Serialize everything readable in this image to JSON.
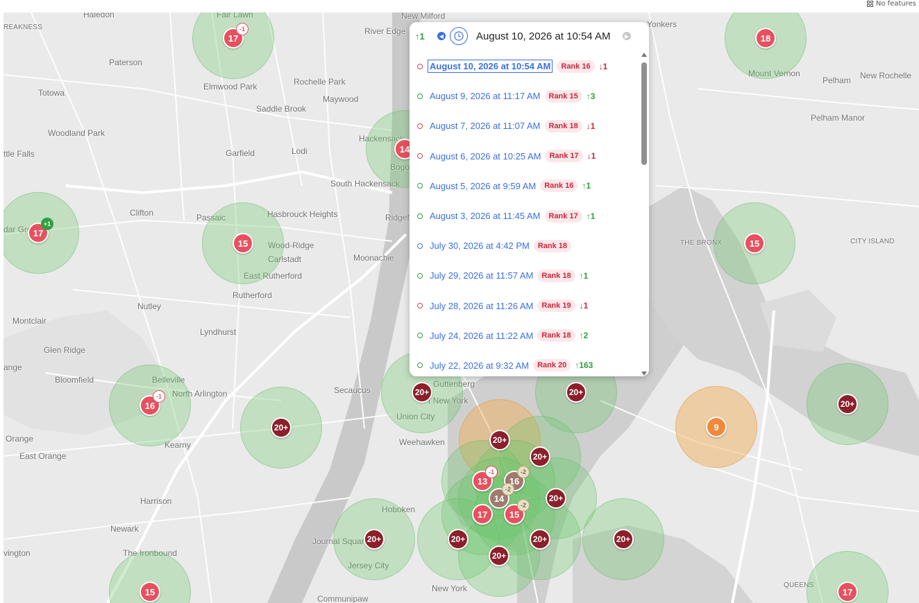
{
  "toolbar": {
    "features_label": "No features",
    "features_icon": "grid-icon"
  },
  "places": [
    {
      "name": "Haledon"
    },
    {
      "name": "Fair Lawn"
    },
    {
      "name": "New Milford"
    },
    {
      "name": "Yonkers"
    },
    {
      "name": "REAKNESS"
    },
    {
      "name": "River Edge"
    },
    {
      "name": "Paterson"
    },
    {
      "name": "Rochelle Park"
    },
    {
      "name": "Elmwood Park"
    },
    {
      "name": "Mount Vernon"
    },
    {
      "name": "Pelham"
    },
    {
      "name": "New Rochelle"
    },
    {
      "name": "Totowa"
    },
    {
      "name": "Maywood"
    },
    {
      "name": "Saddle Brook"
    },
    {
      "name": "Pelham Manor"
    },
    {
      "name": "Woodland Park"
    },
    {
      "name": "Hackensack"
    },
    {
      "name": "ttle Falls"
    },
    {
      "name": "Garfield"
    },
    {
      "name": "Lodi"
    },
    {
      "name": "Bogo"
    },
    {
      "name": "South Hackensack"
    },
    {
      "name": "Clifton"
    },
    {
      "name": "Passaic"
    },
    {
      "name": "Hasbrouck Heights"
    },
    {
      "name": "Ridgef"
    },
    {
      "name": "dar Gro"
    },
    {
      "name": "Wood-Ridge"
    },
    {
      "name": "THE BRONX"
    },
    {
      "name": "CITY ISLAND"
    },
    {
      "name": "Carlstadt"
    },
    {
      "name": "Moonachie"
    },
    {
      "name": "East Rutherford"
    },
    {
      "name": "Rutherford"
    },
    {
      "name": "Nutley"
    },
    {
      "name": "Montclair"
    },
    {
      "name": "Lyndhurst"
    },
    {
      "name": "Glen Ridge"
    },
    {
      "name": "ange"
    },
    {
      "name": "Belleville"
    },
    {
      "name": "Bloomfield"
    },
    {
      "name": "North Arlington"
    },
    {
      "name": "Secaucus"
    },
    {
      "name": "Guttenberg"
    },
    {
      "name": "t New York"
    },
    {
      "name": "Union City"
    },
    {
      "name": "Orange"
    },
    {
      "name": "Kearny"
    },
    {
      "name": "East Orange"
    },
    {
      "name": "Weehawken"
    },
    {
      "name": "Harrison"
    },
    {
      "name": "Hoboken"
    },
    {
      "name": "Newark"
    },
    {
      "name": "Journal Squar"
    },
    {
      "name": "vington"
    },
    {
      "name": "The Ironbound"
    },
    {
      "name": "Jersey City"
    },
    {
      "name": "New York"
    },
    {
      "name": "QUEENS"
    },
    {
      "name": "Communipaw"
    }
  ],
  "markers": [
    {
      "label": "17",
      "kind": "red",
      "delta": "-1",
      "delta_kind": "down"
    },
    {
      "label": "18",
      "kind": "red"
    },
    {
      "label": "14",
      "kind": "red"
    },
    {
      "label": "17",
      "kind": "red",
      "delta": "+1",
      "delta_kind": "up"
    },
    {
      "label": "15",
      "kind": "red"
    },
    {
      "label": "15",
      "kind": "red"
    },
    {
      "label": "16",
      "kind": "red",
      "delta": "-1",
      "delta_kind": "down"
    },
    {
      "label": "20+",
      "kind": "dark"
    },
    {
      "label": "20+",
      "kind": "dark"
    },
    {
      "label": "20+",
      "kind": "dark"
    },
    {
      "label": "9",
      "kind": "orange"
    },
    {
      "label": "20+",
      "kind": "dark"
    },
    {
      "label": "20+",
      "kind": "dark"
    },
    {
      "label": "20+",
      "kind": "dark"
    },
    {
      "label": "13",
      "kind": "red",
      "delta": "-1",
      "delta_kind": "down"
    },
    {
      "label": "16",
      "kind": "muted",
      "delta": "-2",
      "delta_kind": "muted"
    },
    {
      "label": "14",
      "kind": "muted",
      "delta": "-2",
      "delta_kind": "muted"
    },
    {
      "label": "17",
      "kind": "red"
    },
    {
      "label": "15",
      "kind": "red",
      "delta": "-2",
      "delta_kind": "muted"
    },
    {
      "label": "20+",
      "kind": "dark"
    },
    {
      "label": "20+",
      "kind": "dark"
    },
    {
      "label": "20+",
      "kind": "dark"
    },
    {
      "label": "20+",
      "kind": "dark"
    },
    {
      "label": "20+",
      "kind": "dark"
    },
    {
      "label": "20+",
      "kind": "dark"
    },
    {
      "label": "15",
      "kind": "red"
    },
    {
      "label": "17",
      "kind": "red"
    }
  ],
  "popup": {
    "header_trend": "↑1",
    "header_date": "August 10, 2026 at 10:54 AM",
    "history": [
      {
        "date": "August 10, 2026 at 10:54 AM",
        "rank": "Rank 16",
        "change": "↓1",
        "trend": "down"
      },
      {
        "date": "August 9, 2026 at 11:17 AM",
        "rank": "Rank 15",
        "change": "↑3",
        "trend": "up"
      },
      {
        "date": "August 7, 2026 at 11:07 AM",
        "rank": "Rank 18",
        "change": "↓1",
        "trend": "down"
      },
      {
        "date": "August 6, 2026 at 10:25 AM",
        "rank": "Rank 17",
        "change": "↓1",
        "trend": "down"
      },
      {
        "date": "August 5, 2026 at 9:59 AM",
        "rank": "Rank 16",
        "change": "↑1",
        "trend": "up"
      },
      {
        "date": "August 3, 2026 at 11:45 AM",
        "rank": "Rank 17",
        "change": "↑1",
        "trend": "up"
      },
      {
        "date": "July 30, 2026 at 4:42 PM",
        "rank": "Rank 18",
        "change": "",
        "trend": "flat"
      },
      {
        "date": "July 29, 2026 at 11:57 AM",
        "rank": "Rank 18",
        "change": "↑1",
        "trend": "up"
      },
      {
        "date": "July 28, 2026 at 11:26 AM",
        "rank": "Rank 19",
        "change": "↓1",
        "trend": "down"
      },
      {
        "date": "July 24, 2026 at 11:22 AM",
        "rank": "Rank 18",
        "change": "↑2",
        "trend": "up"
      },
      {
        "date": "July 22, 2026 at 9:32 AM",
        "rank": "Rank 20",
        "change": "↑163",
        "trend": "up"
      }
    ]
  },
  "colors": {
    "up": "#2ea043",
    "down": "#c8283a",
    "link": "#3b6fe0",
    "halo": "#6ec86e"
  }
}
